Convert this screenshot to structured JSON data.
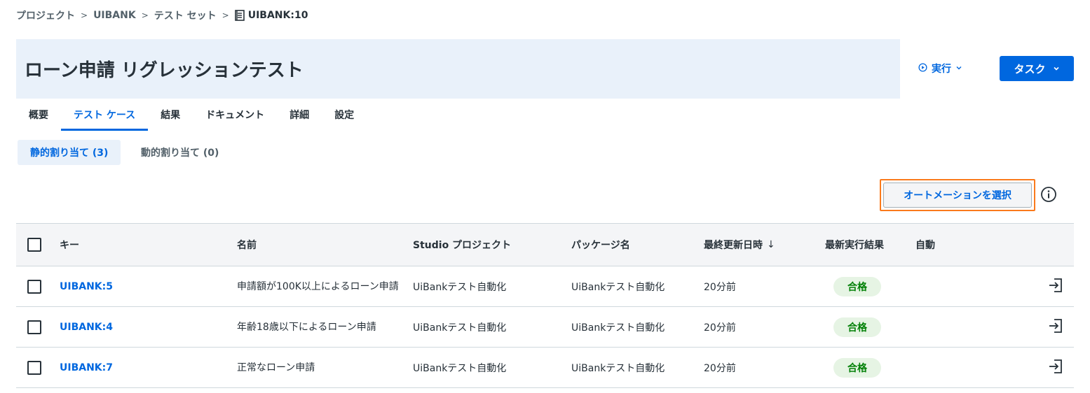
{
  "breadcrumb": {
    "items": [
      "プロジェクト",
      "UIBANK",
      "テスト セット"
    ],
    "current": "UIBANK:10",
    "separator": ">"
  },
  "title": "ローン申請 リグレッションテスト",
  "actions": {
    "run_label": "実行",
    "task_label": "タスク"
  },
  "tabs": [
    "概要",
    "テスト ケース",
    "結果",
    "ドキュメント",
    "詳細",
    "設定"
  ],
  "active_tab": "テスト ケース",
  "subtabs": {
    "static_label": "静的割り当て (3)",
    "dynamic_label": "動的割り当て (0)"
  },
  "select_automation_label": "オートメーションを選択",
  "table": {
    "columns": {
      "key": "キー",
      "name": "名前",
      "studio": "Studio プロジェクト",
      "package": "パッケージ名",
      "updated": "最終更新日時",
      "sort_indicator": "↓",
      "result": "最新実行結果",
      "auto": "自動"
    },
    "rows": [
      {
        "key": "UIBANK:5",
        "name": "申請額が100K以上によるローン申請",
        "studio": "UiBankテスト自動化",
        "package": "UiBankテスト自動化",
        "updated": "20分前",
        "result": "合格"
      },
      {
        "key": "UIBANK:4",
        "name": "年齢18歳以下によるローン申請",
        "studio": "UiBankテスト自動化",
        "package": "UiBankテスト自動化",
        "updated": "20分前",
        "result": "合格"
      },
      {
        "key": "UIBANK:7",
        "name": "正常なローン申請",
        "studio": "UiBankテスト自動化",
        "package": "UiBankテスト自動化",
        "updated": "20分前",
        "result": "合格"
      }
    ]
  },
  "colors": {
    "accent": "#0067df",
    "banner": "#e9f1fa",
    "highlight": "#fa7a1c",
    "pass_bg": "#e6f4e4",
    "pass_text": "#038108"
  },
  "icons": {
    "breadcrumb_doc": "document-icon",
    "run": "play-circle-icon",
    "info": "info-icon",
    "row_action": "open-in-icon"
  }
}
